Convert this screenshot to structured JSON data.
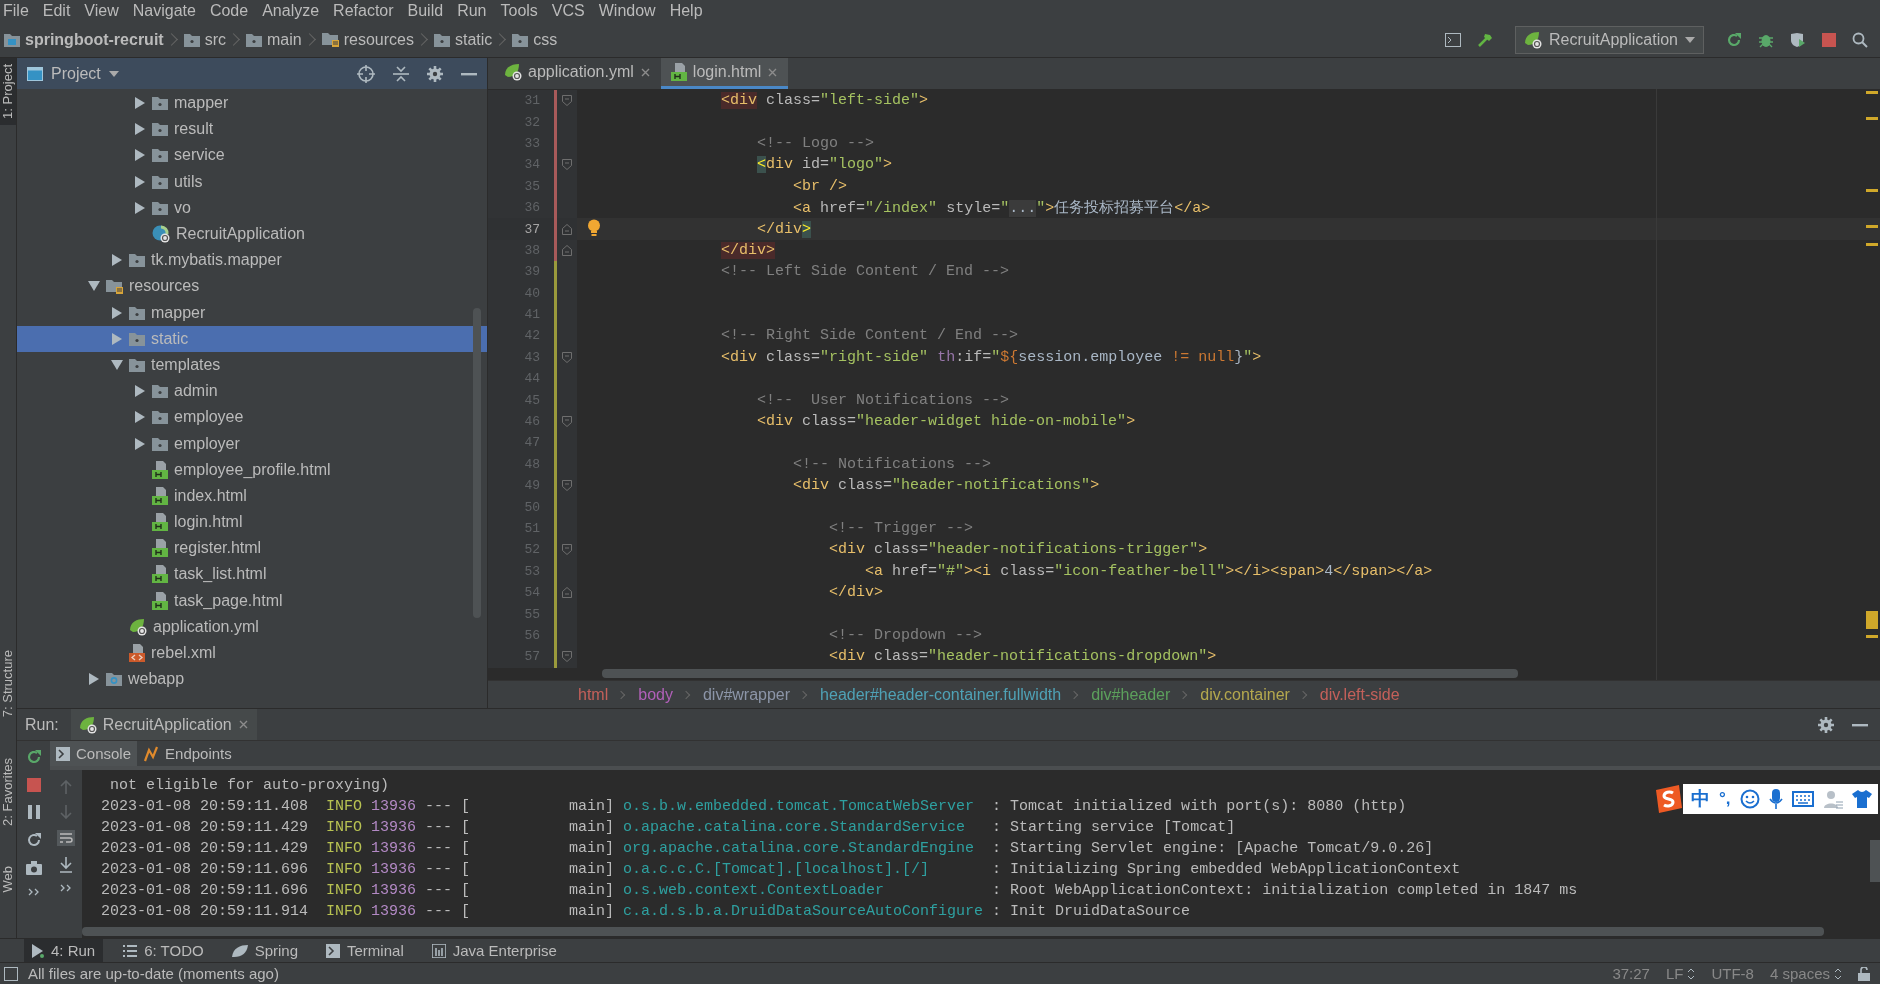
{
  "menu": [
    "File",
    "Edit",
    "View",
    "Navigate",
    "Code",
    "Analyze",
    "Refactor",
    "Build",
    "Run",
    "Tools",
    "VCS",
    "Window",
    "Help"
  ],
  "nav_bar": {
    "path": [
      {
        "label": "springboot-recruit",
        "kind": "module"
      },
      {
        "label": "src",
        "kind": "folder"
      },
      {
        "label": "main",
        "kind": "folder"
      },
      {
        "label": "resources",
        "kind": "resource-folder"
      },
      {
        "label": "static",
        "kind": "folder"
      },
      {
        "label": "css",
        "kind": "folder"
      }
    ],
    "run_config": "RecruitApplication"
  },
  "side_stripe": {
    "top": [
      "1: Project"
    ],
    "bottom": [
      "7: Structure",
      "2: Favorites",
      "Web"
    ]
  },
  "project_panel": {
    "title": "Project",
    "tree": [
      {
        "children": [
          {
            "children": [
              {
                "label": "mapper",
                "kind": "folder",
                "expanded": false,
                "selected": false
              },
              {
                "label": "result",
                "kind": "folder",
                "expanded": false,
                "selected": false
              },
              {
                "label": "service",
                "kind": "folder",
                "expanded": false,
                "selected": false
              },
              {
                "label": "utils",
                "kind": "folder",
                "expanded": false,
                "selected": false
              },
              {
                "label": "vo",
                "kind": "folder",
                "expanded": false,
                "selected": false
              },
              {
                "label": "RecruitApplication",
                "kind": "spring-class",
                "selected": false
              }
            ]
          },
          {
            "label": "tk.mybatis.mapper",
            "kind": "folder",
            "expanded": false,
            "selected": false
          }
        ]
      },
      {
        "label": "resources",
        "kind": "resource-folder",
        "expanded": true,
        "selected": false,
        "children": [
          {
            "label": "mapper",
            "kind": "folder",
            "expanded": false,
            "selected": false
          },
          {
            "label": "static",
            "kind": "folder",
            "expanded": false,
            "selected": true
          },
          {
            "label": "templates",
            "kind": "folder",
            "expanded": true,
            "selected": false,
            "children": [
              {
                "label": "admin",
                "kind": "folder",
                "expanded": false,
                "selected": false
              },
              {
                "label": "employee",
                "kind": "folder",
                "expanded": false,
                "selected": false
              },
              {
                "label": "employer",
                "kind": "folder",
                "expanded": false,
                "selected": false
              },
              {
                "label": "employee_profile.html",
                "kind": "html",
                "selected": false
              },
              {
                "label": "index.html",
                "kind": "html",
                "selected": false
              },
              {
                "label": "login.html",
                "kind": "html",
                "selected": false
              },
              {
                "label": "register.html",
                "kind": "html",
                "selected": false
              },
              {
                "label": "task_list.html",
                "kind": "html",
                "selected": false
              },
              {
                "label": "task_page.html",
                "kind": "html",
                "selected": false
              }
            ]
          },
          {
            "label": "application.yml",
            "kind": "yml",
            "selected": false
          },
          {
            "label": "rebel.xml",
            "kind": "xml",
            "selected": false
          }
        ]
      },
      {
        "label": "webapp",
        "kind": "web-folder",
        "expanded": false,
        "selected": false
      }
    ]
  },
  "editor": {
    "tabs": [
      {
        "label": "application.yml",
        "kind": "yml",
        "selected": false
      },
      {
        "label": "login.html",
        "kind": "html",
        "selected": true
      }
    ],
    "lines": [
      {
        "number": "31",
        "color": "#a85a5a",
        "current": false,
        "kind": "fold-start",
        "tokens": [
          {
            "text": "                <div",
            "kind": "tagerr"
          },
          {
            "text": " class=",
            "kind": "attr"
          },
          {
            "text": "\"left-side\"",
            "kind": "str"
          },
          {
            "text": ">",
            "kind": "tag"
          }
        ]
      },
      {
        "number": "32",
        "color": "#a85a5a",
        "current": false,
        "kind": "plain"
      },
      {
        "number": "33",
        "color": "#a85a5a",
        "current": false,
        "kind": "plain",
        "tokens": [
          {
            "text": "                    <!-- Logo -->",
            "kind": "cmt"
          }
        ]
      },
      {
        "number": "34",
        "color": "#a85a5a",
        "current": false,
        "kind": "fold-start",
        "tokens": [
          {
            "text": "                    <",
            "kind": "tagmatch"
          },
          {
            "text": "div",
            "kind": "tag"
          },
          {
            "text": " id=",
            "kind": "attr"
          },
          {
            "text": "\"logo\"",
            "kind": "str"
          },
          {
            "text": ">",
            "kind": "tag"
          }
        ]
      },
      {
        "number": "35",
        "color": "#a85a5a",
        "current": false,
        "kind": "plain",
        "tokens": [
          {
            "text": "                        <br />",
            "kind": "tag"
          }
        ]
      },
      {
        "number": "36",
        "color": "#a85a5a",
        "current": false,
        "kind": "plain",
        "tokens": [
          {
            "text": "                        <a",
            "kind": "tag"
          },
          {
            "text": " href=",
            "kind": "attr"
          },
          {
            "text": "\"/index\"",
            "kind": "str"
          },
          {
            "text": " style=",
            "kind": "attr"
          },
          {
            "text": "\"",
            "kind": "str"
          },
          {
            "text": "...",
            "kind": "fold"
          },
          {
            "text": "\"",
            "kind": "str"
          },
          {
            "text": ">",
            "kind": "tag"
          },
          {
            "text": "任务投标招募平台",
            "kind": "txt"
          },
          {
            "text": "</a>",
            "kind": "tag"
          }
        ]
      },
      {
        "number": "37",
        "color": "#a85a5a",
        "current": true,
        "kind": "fold-end",
        "tokens": [
          {
            "text": "                    </div",
            "kind": "tag"
          },
          {
            "text": ">",
            "kind": "tagmatch"
          }
        ]
      },
      {
        "number": "38",
        "color": "#a85a5a",
        "current": false,
        "kind": "fold-end",
        "tokens": [
          {
            "text": "                </div>",
            "kind": "tagerr"
          }
        ]
      },
      {
        "number": "39",
        "color": "#9a9a3c",
        "current": false,
        "kind": "plain",
        "tokens": [
          {
            "text": "                <!-- Left Side Content / End -->",
            "kind": "cmt"
          }
        ]
      },
      {
        "number": "40",
        "color": "#9a9a3c",
        "current": false,
        "kind": "plain"
      },
      {
        "number": "41",
        "color": "#9a9a3c",
        "current": false,
        "kind": "plain"
      },
      {
        "number": "42",
        "color": "#9a9a3c",
        "current": false,
        "kind": "plain",
        "tokens": [
          {
            "text": "                <!-- Right Side Content / End -->",
            "kind": "cmt"
          }
        ]
      },
      {
        "number": "43",
        "color": "#9a9a3c",
        "current": false,
        "kind": "fold-start",
        "tokens": [
          {
            "text": "                <div",
            "kind": "tag"
          },
          {
            "text": " class=",
            "kind": "attr"
          },
          {
            "text": "\"right-side\"",
            "kind": "str"
          },
          {
            "text": " th",
            "kind": "th"
          },
          {
            "text": ":if=",
            "kind": "attr"
          },
          {
            "text": "\"",
            "kind": "str"
          },
          {
            "text": "${",
            "kind": "kw"
          },
          {
            "text": "session.employee",
            "kind": "txt"
          },
          {
            "text": " !=",
            "kind": "kw"
          },
          {
            "text": " null",
            "kind": "kw"
          },
          {
            "text": "}",
            "kind": "txt"
          },
          {
            "text": "\"",
            "kind": "str"
          },
          {
            "text": ">",
            "kind": "tag"
          }
        ]
      },
      {
        "number": "44",
        "color": "#9a9a3c",
        "current": false,
        "kind": "plain"
      },
      {
        "number": "45",
        "color": "#9a9a3c",
        "current": false,
        "kind": "plain",
        "tokens": [
          {
            "text": "                    <!--  User Notifications -->",
            "kind": "cmt"
          }
        ]
      },
      {
        "number": "46",
        "color": "#9a9a3c",
        "current": false,
        "kind": "fold-start",
        "tokens": [
          {
            "text": "                    <div",
            "kind": "tag"
          },
          {
            "text": " class=",
            "kind": "attr"
          },
          {
            "text": "\"header-widget hide-on-mobile\"",
            "kind": "str"
          },
          {
            "text": ">",
            "kind": "tag"
          }
        ]
      },
      {
        "number": "47",
        "color": "#9a9a3c",
        "current": false,
        "kind": "plain"
      },
      {
        "number": "48",
        "color": "#9a9a3c",
        "current": false,
        "kind": "plain",
        "tokens": [
          {
            "text": "                        <!-- Notifications -->",
            "kind": "cmt"
          }
        ]
      },
      {
        "number": "49",
        "color": "#9a9a3c",
        "current": false,
        "kind": "fold-start",
        "tokens": [
          {
            "text": "                        <div",
            "kind": "tag"
          },
          {
            "text": " class=",
            "kind": "attr"
          },
          {
            "text": "\"header-notifications\"",
            "kind": "str"
          },
          {
            "text": ">",
            "kind": "tag"
          }
        ]
      },
      {
        "number": "50",
        "color": "#9a9a3c",
        "current": false,
        "kind": "plain"
      },
      {
        "number": "51",
        "color": "#9a9a3c",
        "current": false,
        "kind": "plain",
        "tokens": [
          {
            "text": "                            <!-- Trigger -->",
            "kind": "cmt"
          }
        ]
      },
      {
        "number": "52",
        "color": "#9a9a3c",
        "current": false,
        "kind": "fold-start",
        "tokens": [
          {
            "text": "                            <div",
            "kind": "tag"
          },
          {
            "text": " class=",
            "kind": "attr"
          },
          {
            "text": "\"header-notifications-trigger\"",
            "kind": "str"
          },
          {
            "text": ">",
            "kind": "tag"
          }
        ]
      },
      {
        "number": "53",
        "color": "#9a9a3c",
        "current": false,
        "kind": "plain",
        "tokens": [
          {
            "text": "                                <a",
            "kind": "tag"
          },
          {
            "text": " href=",
            "kind": "attr"
          },
          {
            "text": "\"#\"",
            "kind": "str"
          },
          {
            "text": "><i",
            "kind": "tag"
          },
          {
            "text": " class=",
            "kind": "attr"
          },
          {
            "text": "\"icon-feather-bell\"",
            "kind": "str"
          },
          {
            "text": "></i><span>",
            "kind": "tag"
          },
          {
            "text": "4",
            "kind": "txt"
          },
          {
            "text": "</span></a>",
            "kind": "tag"
          }
        ]
      },
      {
        "number": "54",
        "color": "#9a9a3c",
        "current": false,
        "kind": "fold-end",
        "tokens": [
          {
            "text": "                            </div>",
            "kind": "tag"
          }
        ]
      },
      {
        "number": "55",
        "color": "#9a9a3c",
        "current": false,
        "kind": "plain"
      },
      {
        "number": "56",
        "color": "#9a9a3c",
        "current": false,
        "kind": "plain",
        "tokens": [
          {
            "text": "                            <!-- Dropdown -->",
            "kind": "cmt"
          }
        ]
      },
      {
        "number": "57",
        "color": "#9a9a3c",
        "current": false,
        "kind": "fold-start",
        "tokens": [
          {
            "text": "                            <div",
            "kind": "tag"
          },
          {
            "text": " class=",
            "kind": "attr"
          },
          {
            "text": "\"header-notifications-dropdown\"",
            "kind": "str"
          },
          {
            "text": ">",
            "kind": "tag"
          }
        ]
      }
    ],
    "breadcrumbs": [
      {
        "label": "html",
        "color": "#c4605a"
      },
      {
        "label": "body",
        "color": "#b060b8"
      },
      {
        "label": "div#wrapper",
        "color": "#8c95a8"
      },
      {
        "label": "header#header-container.fullwidth",
        "color": "#4fa2b6"
      },
      {
        "label": "div#header",
        "color": "#5ca05c"
      },
      {
        "label": "div.container",
        "color": "#b4a84e"
      },
      {
        "label": "div.left-side",
        "color": "#c4605a"
      }
    ]
  },
  "run_panel": {
    "title": "Run:",
    "config": "RecruitApplication",
    "tabs": [
      {
        "label": "Console",
        "kind": "console",
        "selected": true
      },
      {
        "label": "Endpoints",
        "kind": "endpoints",
        "selected": false
      }
    ],
    "lines": [
      {
        "kind": "text",
        "text": " not eligible for auto-proxying)"
      },
      {
        "kind": "log",
        "time": "2023-01-08 20:59:11.408",
        "level": "INFO",
        "pid": "13936",
        "separator": "--- [",
        "thread": "main]",
        "logger": "o.s.b.w.embedded.tomcat.TomcatWebServer",
        "message": ": Tomcat initialized with port(s): 8080 (http)"
      },
      {
        "kind": "log",
        "time": "2023-01-08 20:59:11.429",
        "level": "INFO",
        "pid": "13936",
        "separator": "--- [",
        "thread": "main]",
        "logger": "o.apache.catalina.core.StandardService",
        "message": ": Starting service [Tomcat]"
      },
      {
        "kind": "log",
        "time": "2023-01-08 20:59:11.429",
        "level": "INFO",
        "pid": "13936",
        "separator": "--- [",
        "thread": "main]",
        "logger": "org.apache.catalina.core.StandardEngine",
        "message": ": Starting Servlet engine: [Apache Tomcat/9.0.26]"
      },
      {
        "kind": "log",
        "time": "2023-01-08 20:59:11.696",
        "level": "INFO",
        "pid": "13936",
        "separator": "--- [",
        "thread": "main]",
        "logger": "o.a.c.c.C.[Tomcat].[localhost].[/]",
        "message": ": Initializing Spring embedded WebApplicationContext"
      },
      {
        "kind": "log",
        "time": "2023-01-08 20:59:11.696",
        "level": "INFO",
        "pid": "13936",
        "separator": "--- [",
        "thread": "main]",
        "logger": "o.s.web.context.ContextLoader",
        "message": ": Root WebApplicationContext: initialization completed in 1847 ms"
      },
      {
        "kind": "log",
        "time": "2023-01-08 20:59:11.914",
        "level": "INFO",
        "pid": "13936",
        "separator": "--- [",
        "thread": "main]",
        "logger": "c.a.d.s.b.a.DruidDataSourceAutoConfigure",
        "message": ": Init DruidDataSource"
      }
    ]
  },
  "tool_buttons": [
    {
      "label": "4: Run",
      "kind": "run",
      "selected": true
    },
    {
      "label": "6: TODO",
      "kind": "todo",
      "selected": false
    },
    {
      "label": "Spring",
      "kind": "spring",
      "selected": false
    },
    {
      "label": "Terminal",
      "kind": "terminal",
      "selected": false
    },
    {
      "label": "Java Enterprise",
      "kind": "enterprise",
      "selected": false
    }
  ],
  "status_bar": {
    "message": "All files are up-to-date (moments ago)",
    "position": "37:27",
    "line_separator": "LF",
    "encoding": "UTF-8",
    "indent": "4 spaces"
  },
  "ime_toolbar": {
    "mode": "中",
    "punctuation": "°,"
  }
}
